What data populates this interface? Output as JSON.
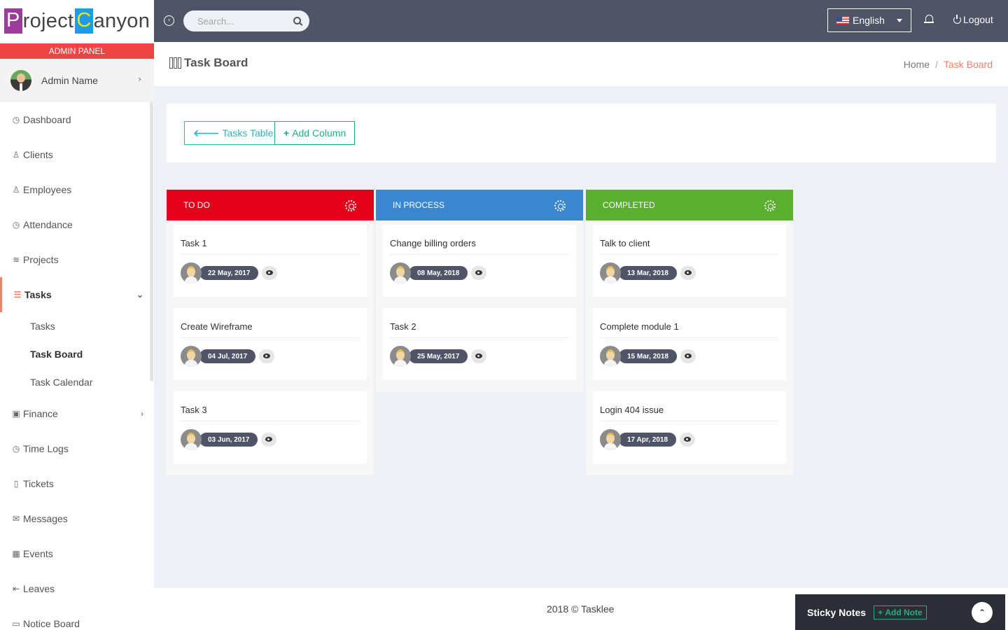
{
  "brand": {
    "logo_p": "P",
    "logo_mid": "roject",
    "logo_c": "C",
    "logo_end": "anyon",
    "panel_label": "ADMIN PANEL"
  },
  "user": {
    "name": "Admin Name"
  },
  "sidebar": {
    "items": [
      {
        "label": "Dashboard",
        "icon": "dashboard-icon"
      },
      {
        "label": "Clients",
        "icon": "clients-icon"
      },
      {
        "label": "Employees",
        "icon": "employees-icon"
      },
      {
        "label": "Attendance",
        "icon": "clock-icon"
      },
      {
        "label": "Projects",
        "icon": "layers-icon"
      },
      {
        "label": "Tasks",
        "icon": "list-icon"
      },
      {
        "label": "Finance",
        "icon": "money-icon"
      },
      {
        "label": "Time Logs",
        "icon": "clock-icon"
      },
      {
        "label": "Tickets",
        "icon": "ticket-icon"
      },
      {
        "label": "Messages",
        "icon": "envelope-icon"
      },
      {
        "label": "Events",
        "icon": "calendar-icon"
      },
      {
        "label": "Leaves",
        "icon": "logout-icon"
      },
      {
        "label": "Notice Board",
        "icon": "screen-icon"
      }
    ],
    "task_sub": [
      "Tasks",
      "Task Board",
      "Task Calendar"
    ]
  },
  "topbar": {
    "search_placeholder": "Search...",
    "language": "English",
    "logout": "Logout"
  },
  "page": {
    "title": "Task Board",
    "breadcrumb_home": "Home",
    "breadcrumb_current": "Task Board"
  },
  "actions": {
    "tasks_table": "Tasks Table",
    "add_column": "Add Column"
  },
  "board": {
    "columns": [
      {
        "title": "TO DO",
        "color": "#e3001b",
        "cards": [
          {
            "title": "Task 1",
            "date": "22 May, 2017"
          },
          {
            "title": "Create Wireframe",
            "date": "04 Jul, 2017"
          },
          {
            "title": "Task 3",
            "date": "03 Jun, 2017"
          }
        ]
      },
      {
        "title": "IN PROCESS",
        "color": "#3a87d0",
        "cards": [
          {
            "title": "Change billing orders",
            "date": "08 May, 2018"
          },
          {
            "title": "Task 2",
            "date": "25 May, 2017"
          }
        ]
      },
      {
        "title": "COMPLETED",
        "color": "#5aaf2f",
        "cards": [
          {
            "title": "Talk to client",
            "date": "13 Mar, 2018"
          },
          {
            "title": "Complete module 1",
            "date": "15 Mar, 2018"
          },
          {
            "title": "Login 404 issue",
            "date": "17 Apr, 2018"
          }
        ]
      }
    ]
  },
  "footer": {
    "copyright": "2018 © Tasklee"
  },
  "sticky": {
    "label": "Sticky Notes",
    "add_note": "Add Note"
  }
}
